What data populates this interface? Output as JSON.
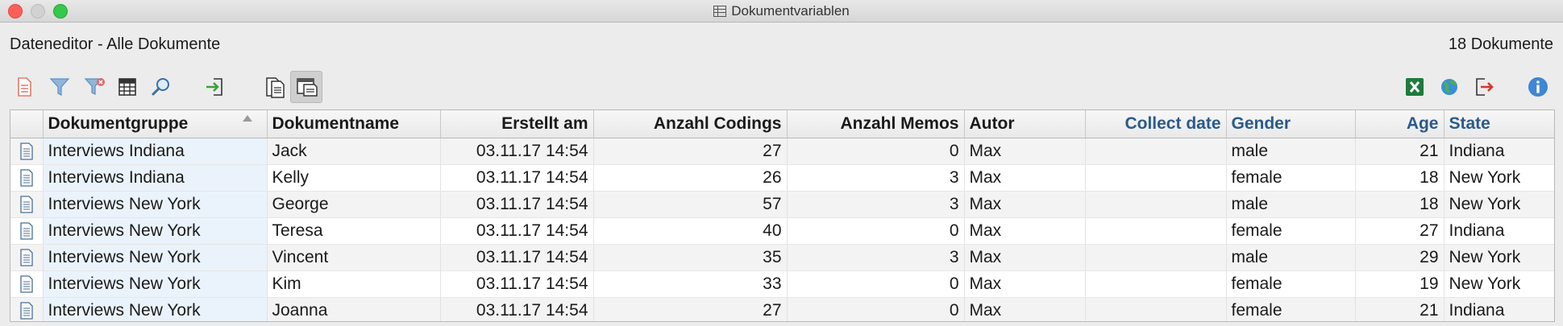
{
  "window": {
    "title": "Dokumentvariablen"
  },
  "header": {
    "title": "Dateneditor - Alle Dokumente",
    "count": "18 Dokumente"
  },
  "toolbar": {
    "left": [
      {
        "name": "new-document-icon"
      },
      {
        "name": "filter-icon"
      },
      {
        "name": "clear-filter-icon"
      },
      {
        "name": "table-view-icon"
      },
      {
        "name": "search-icon"
      },
      {
        "name": "import-icon"
      },
      {
        "name": "document-list-icon"
      },
      {
        "name": "document-window-icon"
      }
    ],
    "right": [
      {
        "name": "excel-icon"
      },
      {
        "name": "globe-icon"
      },
      {
        "name": "export-icon"
      },
      {
        "name": "info-icon"
      }
    ]
  },
  "table": {
    "columns": [
      "Dokumentgruppe",
      "Dokumentname",
      "Erstellt am",
      "Anzahl Codings",
      "Anzahl Memos",
      "Autor",
      "Collect date",
      "Gender",
      "Age",
      "State"
    ],
    "rows": [
      [
        "Interviews Indiana",
        "Jack",
        "03.11.17 14:54",
        "27",
        "0",
        "Max",
        "",
        "male",
        "21",
        "Indiana"
      ],
      [
        "Interviews Indiana",
        "Kelly",
        "03.11.17 14:54",
        "26",
        "3",
        "Max",
        "",
        "female",
        "18",
        "New York"
      ],
      [
        "Interviews New York",
        "George",
        "03.11.17 14:54",
        "57",
        "3",
        "Max",
        "",
        "male",
        "18",
        "New York"
      ],
      [
        "Interviews New York",
        "Teresa",
        "03.11.17 14:54",
        "40",
        "0",
        "Max",
        "",
        "female",
        "27",
        "Indiana"
      ],
      [
        "Interviews New York",
        "Vincent",
        "03.11.17 14:54",
        "35",
        "3",
        "Max",
        "",
        "male",
        "29",
        "New York"
      ],
      [
        "Interviews New York",
        "Kim",
        "03.11.17 14:54",
        "33",
        "0",
        "Max",
        "",
        "female",
        "19",
        "New York"
      ],
      [
        "Interviews New York",
        "Joanna",
        "03.11.17 14:54",
        "27",
        "0",
        "Max",
        "",
        "female",
        "21",
        "Indiana"
      ]
    ]
  },
  "colors": {
    "variable_header": "#2a5a8c",
    "group_cell_bg": "#eaf3fb"
  }
}
